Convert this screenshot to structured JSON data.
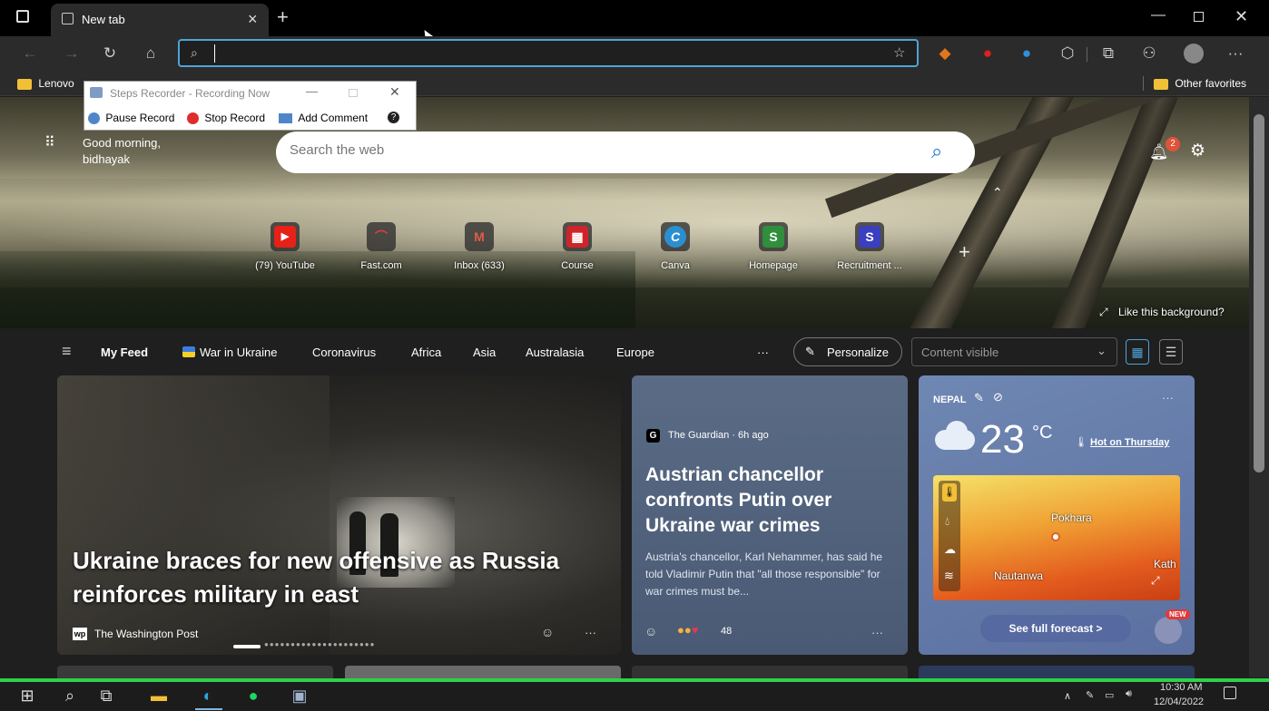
{
  "browser": {
    "tab_title": "New tab",
    "new_tab_glyph": "+",
    "close_tab_glyph": "×",
    "address_value": "",
    "favorites": {
      "left_folder": "Lenovo",
      "right_folder": "Other favorites"
    }
  },
  "steps_recorder": {
    "title": "Steps Recorder - Recording Now",
    "pause": "Pause Record",
    "stop": "Stop Record",
    "add_comment": "Add Comment"
  },
  "newtab": {
    "greeting_line1": "Good morning,",
    "greeting_line2": "bidhayak",
    "search_placeholder": "Search the web",
    "notification_count": "2",
    "like_background": "Like this background?",
    "quick_links": [
      {
        "label": "(79) YouTube",
        "glyph": "▶",
        "color": "#e62117"
      },
      {
        "label": "Fast.com",
        "glyph": "⌒",
        "color": "#c0312d"
      },
      {
        "label": "Inbox (633)",
        "glyph": "M",
        "color": "#d44638"
      },
      {
        "label": "Course",
        "glyph": "▦",
        "color": "#d0242b"
      },
      {
        "label": "Canva",
        "glyph": "C",
        "color": "#2a8fd1"
      },
      {
        "label": "Homepage",
        "glyph": "S",
        "color": "#2f8f3c"
      },
      {
        "label": "Recruitment ...",
        "glyph": "S",
        "color": "#3a3fbf"
      }
    ],
    "add_link_glyph": "+"
  },
  "feed_nav": {
    "items": [
      "My Feed",
      "War in Ukraine",
      "Coronavirus",
      "Africa",
      "Asia",
      "Australasia",
      "Europe"
    ],
    "more": "···",
    "personalize": "Personalize",
    "content_visible": "Content visible"
  },
  "cards": {
    "main": {
      "headline": "Ukraine braces for new offensive as Russia reinforces military in east",
      "source_logo": "wp",
      "source": "The Washington Post",
      "more": "···"
    },
    "guardian": {
      "source": "The Guardian · 6h ago",
      "headline": "Austrian chancellor confronts Putin over Ukraine war crimes",
      "summary": "Austria's chancellor, Karl Nehammer, has said he told Vladimir Putin that \"all those responsible\" for war crimes must be...",
      "reactions": "48",
      "more": "···"
    },
    "weather": {
      "location": "NEPAL",
      "temperature": "23",
      "unit": "°C",
      "hot_link": "Hot on Thursday",
      "map_labels": [
        "Pokhara",
        "Nautanwa",
        "Kath"
      ],
      "forecast_button": "See full forecast >",
      "new_badge": "NEW",
      "more": "···"
    }
  },
  "taskbar": {
    "time": "10:30 AM",
    "date": "12/04/2022"
  }
}
